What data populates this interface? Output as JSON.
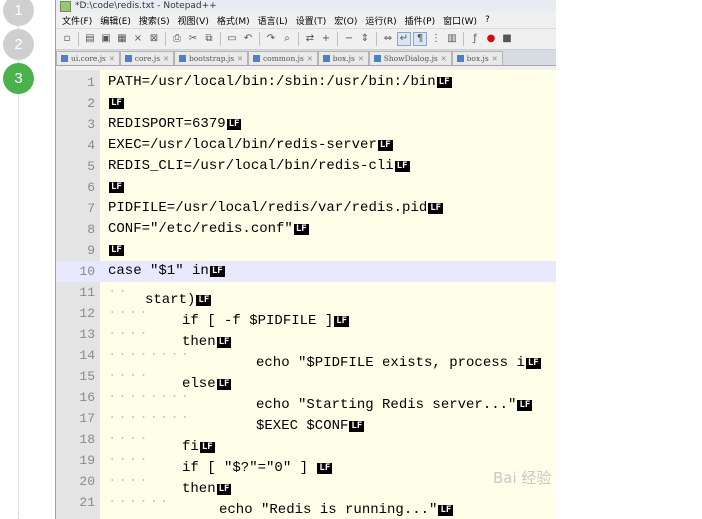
{
  "steps": [
    "1",
    "2",
    "3"
  ],
  "window": {
    "title": "*D:\\code\\redis.txt - Notepad++"
  },
  "menu": [
    "文件(F)",
    "编辑(E)",
    "搜索(S)",
    "视图(V)",
    "格式(M)",
    "语言(L)",
    "设置(T)",
    "宏(O)",
    "运行(R)",
    "插件(P)",
    "窗口(W)",
    "?"
  ],
  "toolbar_icons": [
    "new-file-icon",
    "open-icon",
    "save-icon",
    "save-all-icon",
    "close-icon",
    "close-all-icon",
    "print-icon",
    "cut-icon",
    "copy-icon",
    "paste-icon",
    "undo-icon",
    "redo-icon",
    "find-icon",
    "replace-icon",
    "zoom-in-icon",
    "zoom-out-icon",
    "sync-v-icon",
    "sync-h-icon",
    "wrap-icon",
    "show-all-chars-icon",
    "indent-guide-icon",
    "doc-map-icon",
    "func-list-icon",
    "record-icon",
    "stop-icon"
  ],
  "tabs": [
    "ui.core.js",
    "core.js",
    "bootstrap.js",
    "common.js",
    "box.js",
    "ShowDialog.js",
    "box.js"
  ],
  "editor": {
    "highlight_line": 10,
    "eol_marker": "LF",
    "lines": [
      {
        "n": "1",
        "indent": 0,
        "text": "PATH=/usr/local/bin:/sbin:/usr/bin:/bin"
      },
      {
        "n": "2",
        "indent": 0,
        "text": ""
      },
      {
        "n": "3",
        "indent": 0,
        "text": "REDISPORT=6379"
      },
      {
        "n": "4",
        "indent": 0,
        "text": "EXEC=/usr/local/bin/redis-server"
      },
      {
        "n": "5",
        "indent": 0,
        "text": "REDIS_CLI=/usr/local/bin/redis-cli"
      },
      {
        "n": "6",
        "indent": 0,
        "text": ""
      },
      {
        "n": "7",
        "indent": 0,
        "text": "PIDFILE=/usr/local/redis/var/redis.pid"
      },
      {
        "n": "8",
        "indent": 0,
        "text": "CONF=\"/etc/redis.conf\""
      },
      {
        "n": "9",
        "indent": 0,
        "text": ""
      },
      {
        "n": "10",
        "indent": 0,
        "text": "case \"$1\" in"
      },
      {
        "n": "11",
        "indent": 1,
        "text": "start)"
      },
      {
        "n": "12",
        "indent": 2,
        "text": "if [ -f $PIDFILE ]"
      },
      {
        "n": "13",
        "indent": 2,
        "text": "then"
      },
      {
        "n": "14",
        "indent": 4,
        "text": "echo \"$PIDFILE exists, process i"
      },
      {
        "n": "15",
        "indent": 2,
        "text": "else"
      },
      {
        "n": "16",
        "indent": 4,
        "text": "echo \"Starting Redis server...\""
      },
      {
        "n": "17",
        "indent": 4,
        "text": "$EXEC $CONF"
      },
      {
        "n": "18",
        "indent": 2,
        "text": "fi"
      },
      {
        "n": "19",
        "indent": 2,
        "text": "if [ \"$?\"=\"0\" ] "
      },
      {
        "n": "20",
        "indent": 2,
        "text": "then"
      },
      {
        "n": "21",
        "indent": 3,
        "text": "echo \"Redis is running...\""
      }
    ]
  },
  "watermark": "Bai 经验"
}
